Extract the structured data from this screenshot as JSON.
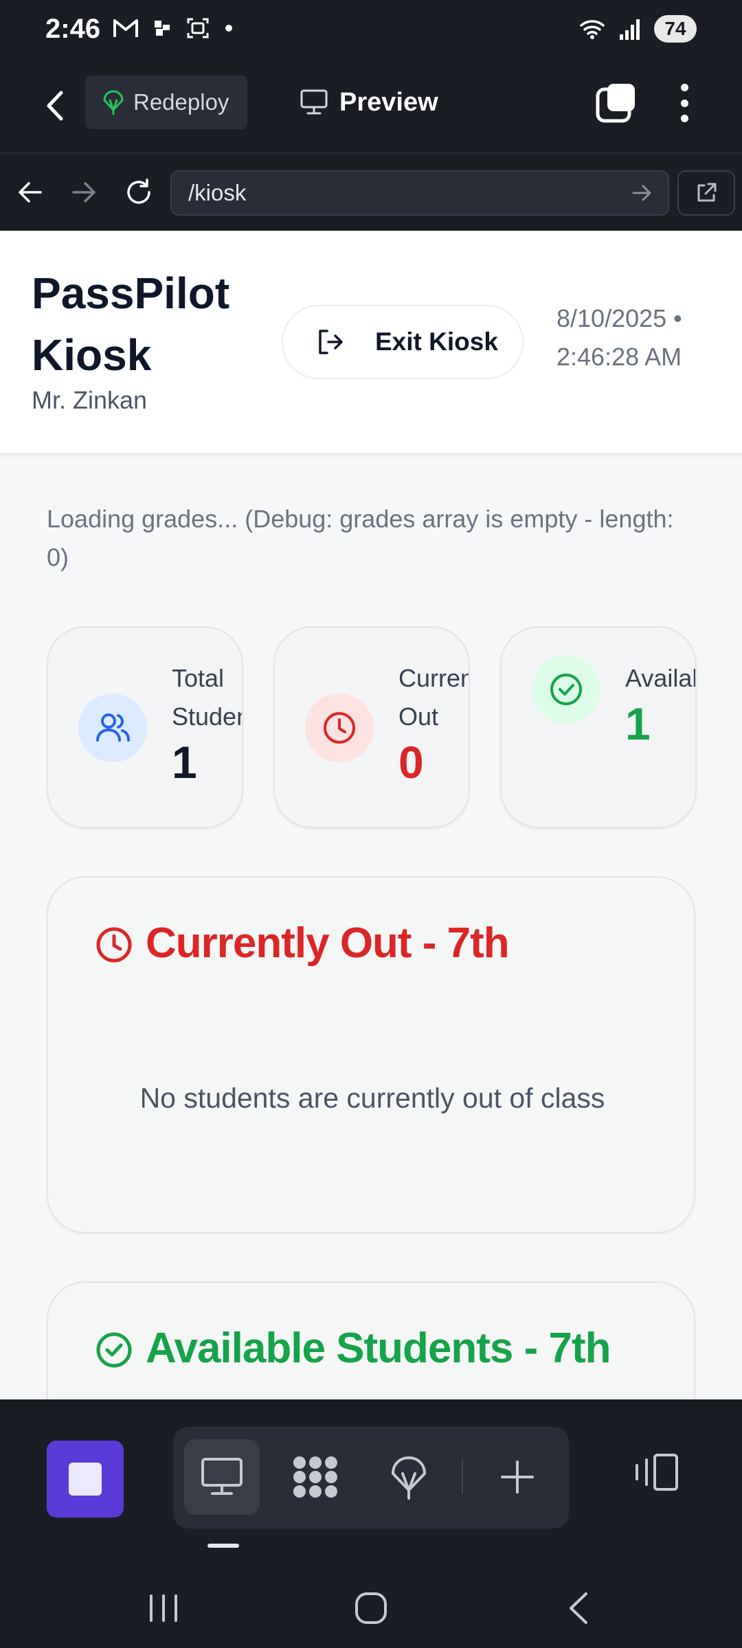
{
  "status_bar": {
    "time": "2:46",
    "battery": "74",
    "left_icons": [
      "gmail-icon",
      "slack-like-icon",
      "screenshot-icon",
      "dot-icon"
    ],
    "right_icons": [
      "wifi-icon",
      "signal-icon"
    ]
  },
  "app_header": {
    "redeploy_label": "Redeploy",
    "preview_label": "Preview"
  },
  "url_bar": {
    "url": "/kiosk"
  },
  "kiosk": {
    "title": "PassPilot Kiosk",
    "teacher": "Mr. Zinkan",
    "exit_label": "Exit Kiosk",
    "datetime": "8/10/2025 • 2:46:28 AM",
    "debug": "Loading grades... (Debug: grades array is empty - length: 0)",
    "stats": [
      {
        "label": "Total Students",
        "value": "1",
        "color": "#111827",
        "icon_bg": "#dbeafe",
        "icon_color": "#2563eb"
      },
      {
        "label": "Currently Out",
        "value": "0",
        "color": "#dc2626",
        "icon_bg": "#fee2e2",
        "icon_color": "#dc2626"
      },
      {
        "label": "Available",
        "value": "1",
        "color": "#16a34a",
        "icon_bg": "#dcfce7",
        "icon_color": "#16a34a"
      }
    ],
    "currently_out": {
      "title": "Currently Out - 7th",
      "empty": "No students are currently out of class",
      "color": "#dc2626"
    },
    "available": {
      "title": "Available Students - 7th",
      "color": "#16a34a"
    }
  },
  "colors": {
    "accent_purple": "#5b3bd8",
    "chrome_bg": "#1b1d25"
  }
}
